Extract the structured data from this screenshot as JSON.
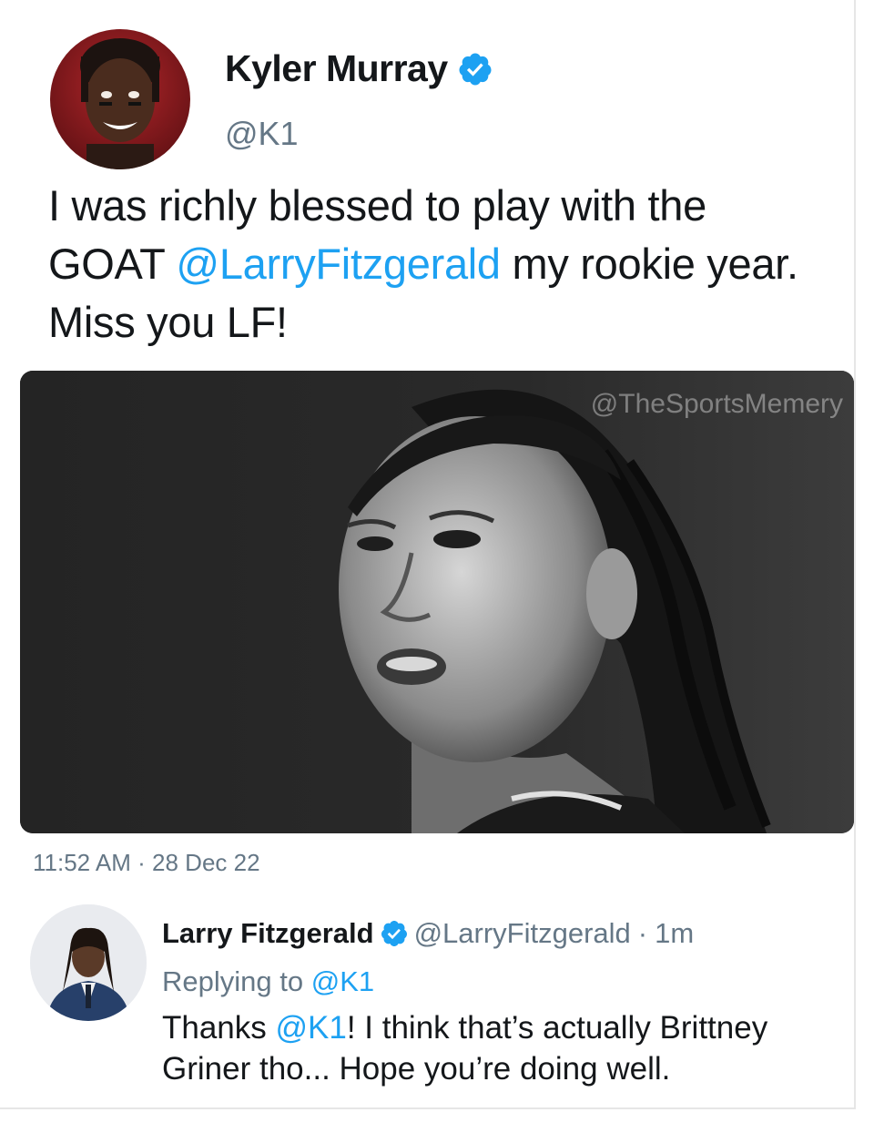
{
  "main_tweet": {
    "display_name": "Kyler Murray",
    "handle": "@K1",
    "verified_icon": "verified-badge-icon",
    "text_before": "I was richly blessed to play with the GOAT ",
    "mention": "@LarryFitzgerald",
    "text_after": " my rookie year. Miss you LF!",
    "media_watermark": "@TheSportsMemery",
    "timestamp": "11:52 AM · 28 Dec 22"
  },
  "reply": {
    "display_name": "Larry Fitzgerald",
    "handle": "@LarryFitzgerald",
    "separator": "·",
    "time": "1m",
    "replying_label": "Replying to ",
    "replying_handle": "@K1",
    "text_before": "Thanks ",
    "mention": "@K1",
    "text_after": "! I think that’s actually Brittney Griner tho... Hope you’re doing well."
  },
  "colors": {
    "link": "#1da1f2",
    "secondary_text": "#657786",
    "primary_text": "#14171a",
    "verified": "#1da1f2"
  }
}
